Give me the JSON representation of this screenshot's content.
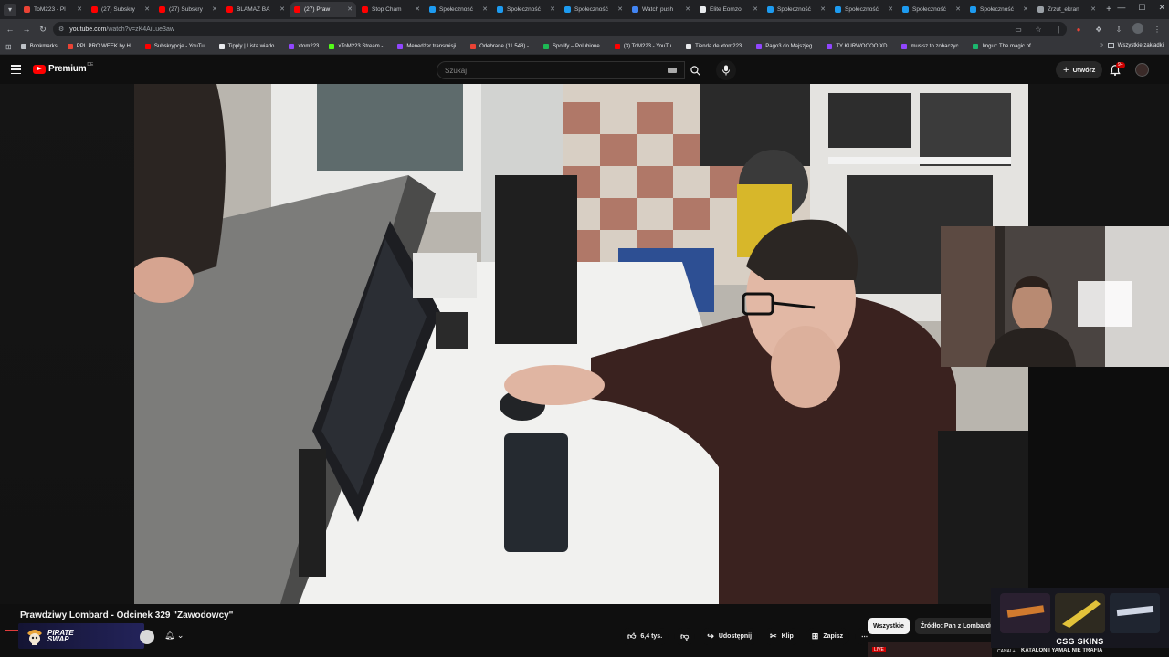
{
  "browser": {
    "tabs": [
      {
        "title": "ToM223 - Pl",
        "color": "#ea4335"
      },
      {
        "title": "(27) Subskry",
        "color": "#ff0000"
      },
      {
        "title": "(27) Subskry",
        "color": "#ff0000"
      },
      {
        "title": "BLAMAZ BA",
        "color": "#ff0000"
      },
      {
        "title": "(27) Praw",
        "color": "#ff0000"
      },
      {
        "title": "Stop Cham",
        "color": "#ff0000"
      },
      {
        "title": "Społeczność",
        "color": "#1d9bf0"
      },
      {
        "title": "Społeczność",
        "color": "#1d9bf0"
      },
      {
        "title": "Społeczność",
        "color": "#1d9bf0"
      },
      {
        "title": "Watch push",
        "color": "#4285f4"
      },
      {
        "title": "Elite Eomzo",
        "color": "#e8eaed"
      },
      {
        "title": "Społeczność",
        "color": "#1d9bf0"
      },
      {
        "title": "Społeczność",
        "color": "#1d9bf0"
      },
      {
        "title": "Społeczność",
        "color": "#1d9bf0"
      },
      {
        "title": "Społeczność",
        "color": "#1d9bf0"
      },
      {
        "title": "Zrzut_ekran",
        "color": "#9aa0a6"
      }
    ],
    "active_tab_index": 4,
    "url_host": "youtube.com",
    "url_path": "/watch?v=zK4AiLue3aw",
    "bookmarks": [
      {
        "label": "Bookmarks",
        "color": "#bdc1c6"
      },
      {
        "label": "PPL PRO WEEK by H...",
        "color": "#ea4335"
      },
      {
        "label": "Subskrypcje - YouTu...",
        "color": "#ff0000"
      },
      {
        "label": "Tipply | Lista wiado...",
        "color": "#e8eaed"
      },
      {
        "label": "xtom223",
        "color": "#9146ff"
      },
      {
        "label": "xToM223 Stream -...",
        "color": "#53fc18"
      },
      {
        "label": "Menedżer transmisji...",
        "color": "#9146ff"
      },
      {
        "label": "Odebrane (11 548) -...",
        "color": "#ea4335"
      },
      {
        "label": "Spotify – Polubione...",
        "color": "#1db954"
      },
      {
        "label": "(3) ToM223 - YouTu...",
        "color": "#ff0000"
      },
      {
        "label": "Tienda de xtom223...",
        "color": "#e8eaed"
      },
      {
        "label": "Pago3 do Majszjeg...",
        "color": "#9146ff"
      },
      {
        "label": "TY KURWOOOO XD...",
        "color": "#9146ff"
      },
      {
        "label": "musisz to zobaczyc...",
        "color": "#9146ff"
      },
      {
        "label": "Imgur: The magic of...",
        "color": "#1bb76e"
      }
    ],
    "bookmarks_all": "Wszystkie zakładki"
  },
  "youtube": {
    "logo": "Premium",
    "logo_country": "DE",
    "search_placeholder": "Szukaj",
    "create_label": "Utwórz",
    "notifications_badge": "9+"
  },
  "video": {
    "title": "Prawdziwy Lombard - Odcinek 329 \"Zawodowcy\"",
    "likes": "6,4 tys.",
    "share_label": "Udostępnij",
    "clip_label": "Klip",
    "save_label": "Zapisz"
  },
  "sponsor": {
    "line1": "PIRATE",
    "line2": "SWAP"
  },
  "chips": [
    {
      "label": "Wszystkie",
      "active": true
    },
    {
      "label": "Źródło: Pan z Lombardu",
      "active": false
    }
  ],
  "csg": {
    "label": "CSG  SKINS",
    "items": [
      "Skin 1",
      "Skin 2",
      "Skin 3"
    ]
  },
  "up_next": {
    "badge": "LIVE",
    "channel": "CANAL+",
    "title": "KATALONII YAMAL NIE TRAFIA"
  },
  "colors": {
    "accent": "#ff0000",
    "background": "#0f0f0f"
  }
}
